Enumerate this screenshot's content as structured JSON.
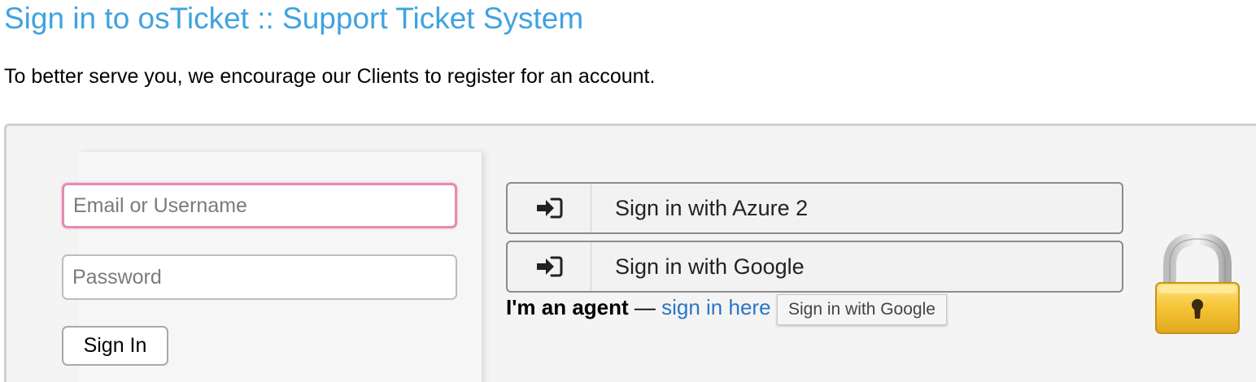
{
  "page": {
    "title": "Sign in to osTicket :: Support Ticket System",
    "intro": "To better serve you, we encourage our Clients to register for an account."
  },
  "login_form": {
    "username_placeholder": "Email or Username",
    "password_placeholder": "Password",
    "submit_label": "Sign In"
  },
  "external_auth": {
    "buttons": [
      {
        "label": "Sign in with Azure 2",
        "icon": "sign-in-icon"
      },
      {
        "label": "Sign in with Google",
        "icon": "sign-in-icon"
      }
    ]
  },
  "agent": {
    "prefix": "I'm an agent",
    "dash": " — ",
    "link_text": "sign in here"
  },
  "tooltip": {
    "text": "Sign in with Google"
  },
  "decor": {
    "lock_icon": "padlock-icon"
  },
  "colors": {
    "title": "#3fa3e0",
    "link": "#2a76c6",
    "focus_border": "#e48bb3",
    "lock_body": "#f2c23a"
  }
}
